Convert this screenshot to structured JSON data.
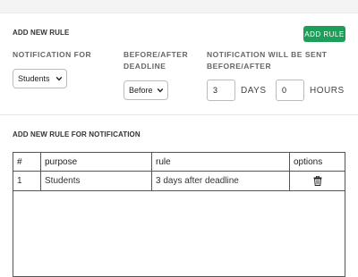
{
  "add_rule": {
    "title": "ADD NEW RULE",
    "button_label": "ADD RULE",
    "notification_for": {
      "label": "NOTIFICATION FOR",
      "selected": "Students"
    },
    "before_after": {
      "label_line1": "BEFORE/AFTER",
      "label_line2": "DEADLINE",
      "selected": "Before"
    },
    "will_be_sent": {
      "label_line1": "NOTIFICATION WILL BE SENT",
      "label_line2": "BEFORE/AFTER",
      "days_value": "3",
      "days_unit": "DAYS",
      "hours_value": "0",
      "hours_unit": "HOURS"
    }
  },
  "notification_rules": {
    "title": "ADD NEW RULE FOR NOTIFICATION",
    "columns": [
      "#",
      "purpose",
      "rule",
      "options"
    ],
    "rows": [
      {
        "num": "1",
        "purpose": "Students",
        "rule": "3 days after deadline",
        "options_icon": "trash-icon"
      }
    ]
  },
  "colors": {
    "accent": "#1e9e59",
    "border": "#555555"
  }
}
